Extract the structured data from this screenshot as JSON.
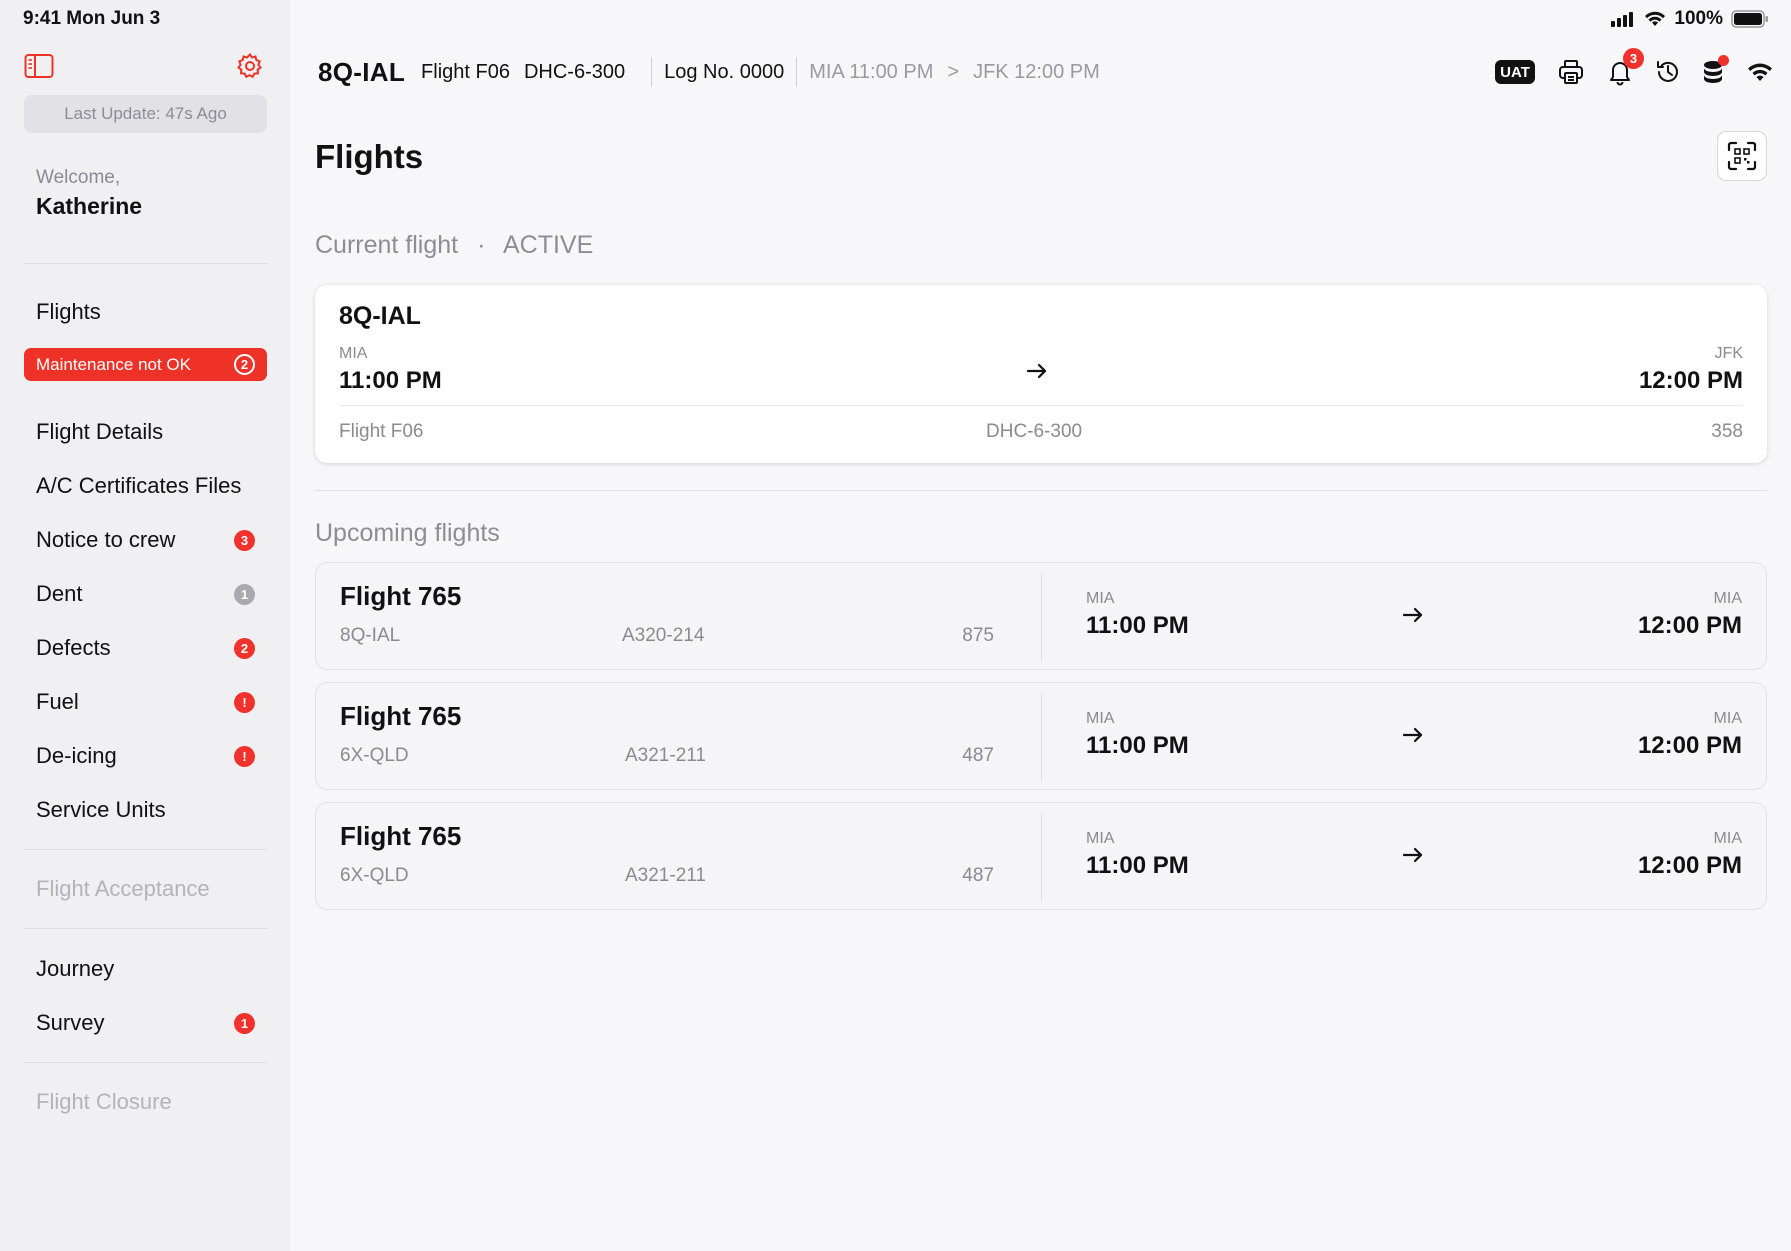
{
  "status_bar": {
    "time": "9:41  Mon Jun 3",
    "battery": "100%"
  },
  "sidebar": {
    "last_update": "Last Update: 47s Ago",
    "welcome": "Welcome,",
    "user_name": "Katherine",
    "flights_label": "Flights",
    "maintenance": {
      "label": "Maintenance not OK",
      "count": "2"
    },
    "items": [
      {
        "label": "Flight Details",
        "badge": ""
      },
      {
        "label": "A/C Certificates Files",
        "badge": ""
      },
      {
        "label": "Notice to crew",
        "badge": "3"
      },
      {
        "label": "Dent",
        "badge": "1"
      },
      {
        "label": "Defects",
        "badge": "2"
      },
      {
        "label": "Fuel",
        "badge": "!"
      },
      {
        "label": "De-icing",
        "badge": "!"
      },
      {
        "label": "Service Units",
        "badge": ""
      }
    ],
    "flight_acceptance": "Flight Acceptance",
    "journey": "Journey",
    "survey": {
      "label": "Survey",
      "badge": "1"
    },
    "flight_closure": "Flight Closure"
  },
  "header": {
    "registration": "8Q-IAL",
    "flight": "Flight F06",
    "aircraft": "DHC-6-300",
    "log": "Log No. 0000",
    "origin": "MIA 11:00 PM",
    "chevron": ">",
    "destination": "JFK 12:00 PM",
    "env_badge": "UAT",
    "notifications_count": "3",
    "colors": {
      "accent": "#ee3228"
    }
  },
  "page": {
    "title": "Flights"
  },
  "current": {
    "section": "Current flight",
    "dot": "·",
    "status": "ACTIVE",
    "registration": "8Q-IAL",
    "from_code": "MIA",
    "from_time": "11:00 PM",
    "to_code": "JFK",
    "to_time": "12:00 PM",
    "flight": "Flight F06",
    "aircraft": "DHC-6-300",
    "number": "358"
  },
  "upcoming": {
    "section": "Upcoming flights",
    "flights": [
      {
        "name": "Flight 765",
        "registration": "8Q-IAL",
        "aircraft": "A320-214",
        "number": "875",
        "from_code": "MIA",
        "from_time": "11:00 PM",
        "to_code": "MIA",
        "to_time": "12:00 PM"
      },
      {
        "name": "Flight 765",
        "registration": "6X-QLD",
        "aircraft": "A321-211",
        "number": "487",
        "from_code": "MIA",
        "from_time": "11:00 PM",
        "to_code": "MIA",
        "to_time": "12:00 PM"
      },
      {
        "name": "Flight 765",
        "registration": "6X-QLD",
        "aircraft": "A321-211",
        "number": "487",
        "from_code": "MIA",
        "from_time": "11:00 PM",
        "to_code": "MIA",
        "to_time": "12:00 PM"
      }
    ]
  }
}
